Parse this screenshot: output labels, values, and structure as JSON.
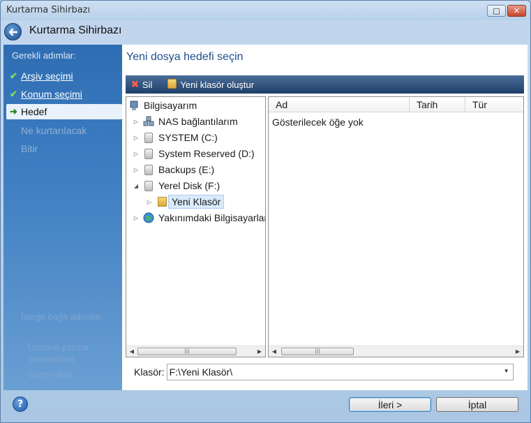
{
  "window": {
    "title": "Kurtarma Sihirbazı"
  },
  "header": {
    "title": "Kurtarma Sihirbazı"
  },
  "sidebar": {
    "heading": "Gerekli adımlar:",
    "steps": [
      {
        "label": "Arşiv seçimi",
        "state": "done"
      },
      {
        "label": "Konum seçimi",
        "state": "done"
      },
      {
        "label": "Hedef",
        "state": "current"
      },
      {
        "label": "Ne kurtarılacak",
        "state": "disabled"
      },
      {
        "label": "Bitir",
        "state": "disabled"
      }
    ],
    "optional_heading": "İsteğe bağlı adımlar:",
    "optional_items": [
      "Üzerine yazma seçenekleri",
      "Seçenekler"
    ]
  },
  "main": {
    "heading": "Yeni dosya hedefi seçin",
    "toolbar": {
      "delete_label": "Sil",
      "new_folder_label": "Yeni klasör oluştur"
    },
    "tree": {
      "root": "Bilgisayarım",
      "items": [
        {
          "label": "NAS bağlantılarım"
        },
        {
          "label": "SYSTEM (C:)"
        },
        {
          "label": "System Reserved (D:)"
        },
        {
          "label": "Backups (E:)"
        },
        {
          "label": "Yerel Disk (F:)"
        },
        {
          "label": "Yeni Klasör"
        },
        {
          "label": "Yakınımdaki Bilgisayarlar"
        }
      ]
    },
    "list": {
      "columns": [
        "Ad",
        "Tarih",
        "Tür"
      ],
      "empty_text": "Gösterilecek öğe yok"
    },
    "folder_label": "Klasör:",
    "folder_value": "F:\\Yeni Klasör\\"
  },
  "footer": {
    "next_label": "İleri >",
    "cancel_label": "İptal"
  },
  "colors": {
    "sidebar_top": "#2f6db3",
    "accent_heading": "#1d4f8e",
    "toolbar": "#1f3f69"
  }
}
